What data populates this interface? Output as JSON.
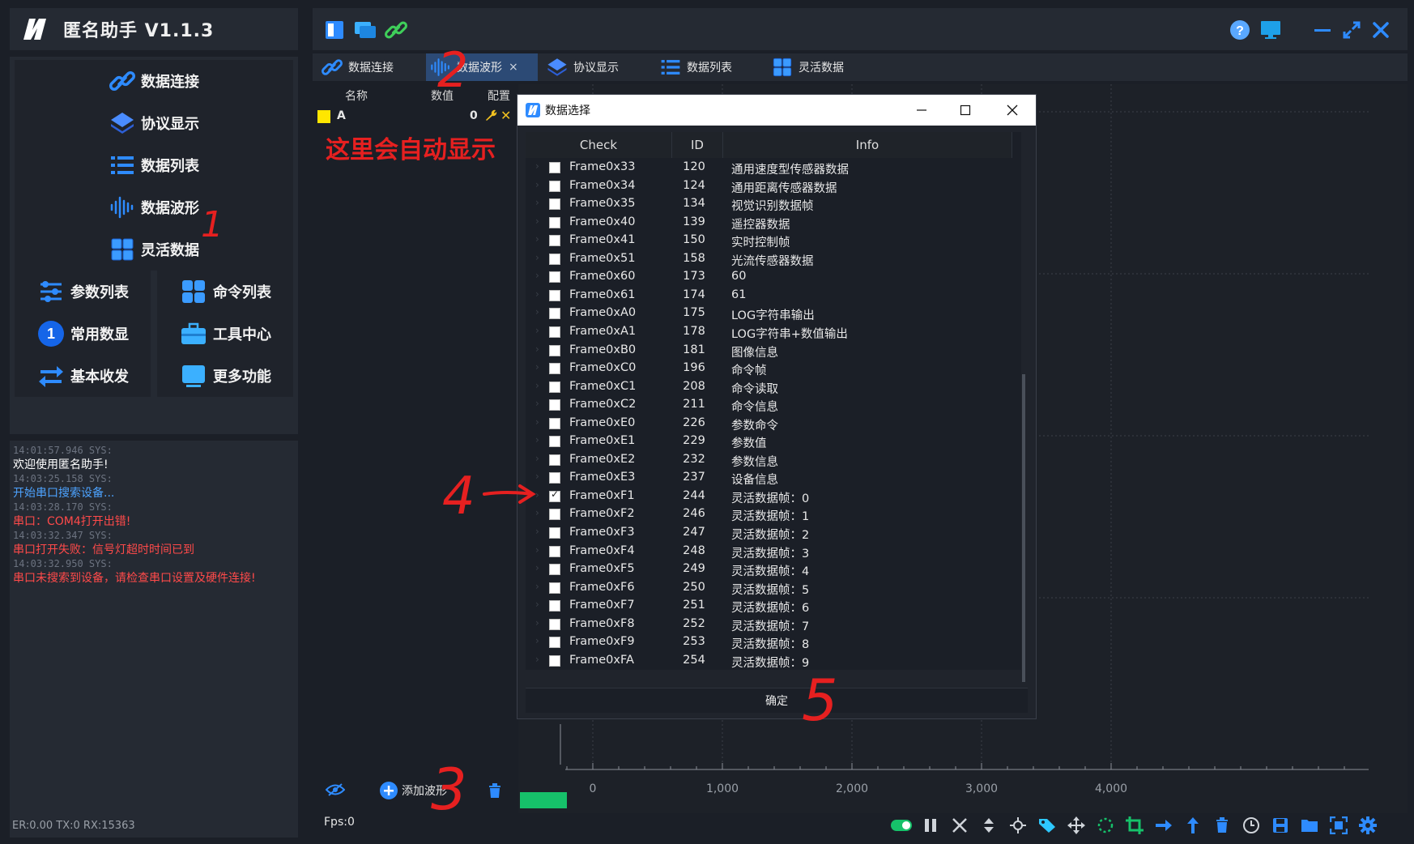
{
  "app": {
    "title": "匿名助手  V1.1.3"
  },
  "nav": {
    "items": [
      {
        "label": "数据连接",
        "icon": "link-icon"
      },
      {
        "label": "协议显示",
        "icon": "layers-icon"
      },
      {
        "label": "数据列表",
        "icon": "list-icon"
      },
      {
        "label": "数据波形",
        "icon": "waveform-icon"
      },
      {
        "label": "灵活数据",
        "icon": "cubes-icon"
      }
    ],
    "grid": [
      {
        "label": "参数列表",
        "icon": "sliders-icon"
      },
      {
        "label": "命令列表",
        "icon": "grid-icon"
      },
      {
        "label": "常用数显",
        "icon": "number-one-icon",
        "badge": "1"
      },
      {
        "label": "工具中心",
        "icon": "toolbox-icon"
      },
      {
        "label": "基本收发",
        "icon": "swap-icon"
      },
      {
        "label": "更多功能",
        "icon": "window-icon"
      }
    ]
  },
  "log": [
    {
      "ts": "14:01:57.946 SYS:",
      "msg": "欢迎使用匿名助手!",
      "color": "#ffffff"
    },
    {
      "ts": "14:03:25.158 SYS:",
      "msg": "开始串口搜索设备...",
      "color": "#4da3ff"
    },
    {
      "ts": "14:03:28.170 SYS:",
      "msg": "串口：COM4打开出错!",
      "color": "#ff4a4a"
    },
    {
      "ts": "14:03:32.347 SYS:",
      "msg": "串口打开失败：信号灯超时时间已到",
      "color": "#ff4a4a"
    },
    {
      "ts": "14:03:32.950 SYS:",
      "msg": "串口未搜索到设备，请检查串口设置及硬件连接!",
      "color": "#ff4a4a"
    }
  ],
  "status": {
    "text": "ER:0.00  TX:0  RX:15363"
  },
  "tabs": [
    {
      "label": "数据连接",
      "icon": "link-icon"
    },
    {
      "label": "数据波形",
      "icon": "waveform-icon",
      "active": true,
      "close": "×"
    },
    {
      "label": "协议显示",
      "icon": "layers-icon"
    },
    {
      "label": "数据列表",
      "icon": "list-icon"
    },
    {
      "label": "灵活数据",
      "icon": "cubes-icon"
    }
  ],
  "wave_list": {
    "headers": {
      "name": "名称",
      "value": "数值",
      "config": "配置"
    },
    "row": {
      "name": "A",
      "value": "0",
      "color": "#ffe600"
    },
    "add_label": "添加波形",
    "fps": "Fps:0"
  },
  "chart_data": {
    "type": "line",
    "x_ticks": [
      "0",
      "1,000",
      "2,000",
      "3,000",
      "4,000"
    ],
    "series": []
  },
  "dialog": {
    "title": "数据选择",
    "columns": {
      "check": "Check",
      "id": "ID",
      "info": "Info"
    },
    "rows": [
      {
        "name": "Frame0x33",
        "id": "120",
        "info": "通用速度型传感器数据",
        "checked": false
      },
      {
        "name": "Frame0x34",
        "id": "124",
        "info": "通用距离传感器数据",
        "checked": false
      },
      {
        "name": "Frame0x35",
        "id": "134",
        "info": "视觉识别数据帧",
        "checked": false
      },
      {
        "name": "Frame0x40",
        "id": "139",
        "info": "遥控器数据",
        "checked": false
      },
      {
        "name": "Frame0x41",
        "id": "150",
        "info": "实时控制帧",
        "checked": false
      },
      {
        "name": "Frame0x51",
        "id": "158",
        "info": "光流传感器数据",
        "checked": false
      },
      {
        "name": "Frame0x60",
        "id": "173",
        "info": "60",
        "checked": false
      },
      {
        "name": "Frame0x61",
        "id": "174",
        "info": "61",
        "checked": false
      },
      {
        "name": "Frame0xA0",
        "id": "175",
        "info": "LOG字符串输出",
        "checked": false
      },
      {
        "name": "Frame0xA1",
        "id": "178",
        "info": "LOG字符串+数值输出",
        "checked": false
      },
      {
        "name": "Frame0xB0",
        "id": "181",
        "info": "图像信息",
        "checked": false
      },
      {
        "name": "Frame0xC0",
        "id": "196",
        "info": "命令帧",
        "checked": false
      },
      {
        "name": "Frame0xC1",
        "id": "208",
        "info": "命令读取",
        "checked": false
      },
      {
        "name": "Frame0xC2",
        "id": "211",
        "info": "命令信息",
        "checked": false
      },
      {
        "name": "Frame0xE0",
        "id": "226",
        "info": "参数命令",
        "checked": false
      },
      {
        "name": "Frame0xE1",
        "id": "229",
        "info": "参数值",
        "checked": false
      },
      {
        "name": "Frame0xE2",
        "id": "232",
        "info": "参数信息",
        "checked": false
      },
      {
        "name": "Frame0xE3",
        "id": "237",
        "info": "设备信息",
        "checked": false
      },
      {
        "name": "Frame0xF1",
        "id": "244",
        "info": "灵活数据帧：0",
        "checked": true
      },
      {
        "name": "Frame0xF2",
        "id": "246",
        "info": "灵活数据帧：1",
        "checked": false
      },
      {
        "name": "Frame0xF3",
        "id": "247",
        "info": "灵活数据帧：2",
        "checked": false
      },
      {
        "name": "Frame0xF4",
        "id": "248",
        "info": "灵活数据帧：3",
        "checked": false
      },
      {
        "name": "Frame0xF5",
        "id": "249",
        "info": "灵活数据帧：4",
        "checked": false
      },
      {
        "name": "Frame0xF6",
        "id": "250",
        "info": "灵活数据帧：5",
        "checked": false
      },
      {
        "name": "Frame0xF7",
        "id": "251",
        "info": "灵活数据帧：6",
        "checked": false
      },
      {
        "name": "Frame0xF8",
        "id": "252",
        "info": "灵活数据帧：7",
        "checked": false
      },
      {
        "name": "Frame0xF9",
        "id": "253",
        "info": "灵活数据帧：8",
        "checked": false
      },
      {
        "name": "Frame0xFA",
        "id": "254",
        "info": "灵活数据帧：9",
        "checked": false
      }
    ],
    "ok_label": "确定"
  },
  "annotations": {
    "note": "这里会自动显示",
    "step1": "1",
    "step2": "2",
    "step3": "3",
    "step4": "4",
    "step5": "5"
  },
  "colors": {
    "accent": "#2e8bff",
    "annotation": "#e62020",
    "panel": "#252a33",
    "background": "#1b1f27"
  }
}
